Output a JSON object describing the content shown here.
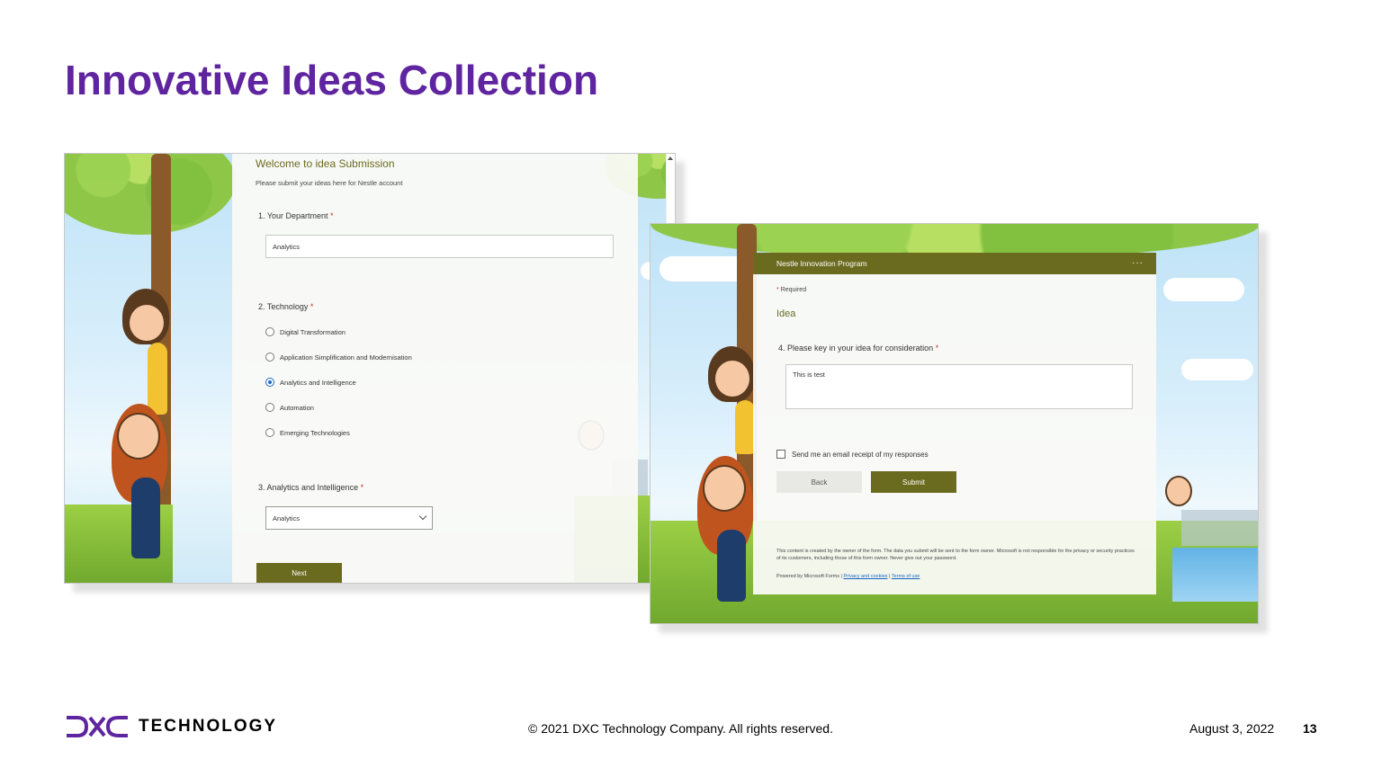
{
  "slide": {
    "title": "Innovative Ideas Collection"
  },
  "form1": {
    "title": "Welcome to idea Submission",
    "subtitle": "Please submit your ideas here for Nestle account",
    "q1": {
      "label": "1. Your Department",
      "required": "*",
      "value": "Analytics"
    },
    "q2": {
      "label": "2. Technology",
      "required": "*",
      "options": [
        {
          "label": "Digital Transformation",
          "checked": false
        },
        {
          "label": "Application Simplification and Modernisation",
          "checked": false
        },
        {
          "label": "Analytics and Intelligence",
          "checked": true
        },
        {
          "label": "Automation",
          "checked": false
        },
        {
          "label": "Emerging Technologies",
          "checked": false
        }
      ]
    },
    "q3": {
      "label": "3. Analytics and Intelligence",
      "required": "*",
      "selected": "Analytics"
    },
    "next_label": "Next"
  },
  "form2": {
    "header": "Nestle Innovation Program",
    "more": "···",
    "required_note": "Required",
    "required_star": "*",
    "section": "Idea",
    "q4": {
      "label": "4. Please key in your idea for consideration",
      "required": "*",
      "value": "This is test"
    },
    "receipt_label": "Send me an email receipt of my responses",
    "back_label": "Back",
    "submit_label": "Submit",
    "disclaimer": "This content is created by the owner of the form. The data you submit will be sent to the form owner. Microsoft is not responsible for the privacy or security practices of its customers, including those of this form owner. Never give out your password.",
    "powered_by": "Powered by Microsoft Forms |",
    "privacy_link": "Privacy and cookies",
    "separator": "|",
    "terms_link": "Terms of use"
  },
  "footer": {
    "logo_text": "TECHNOLOGY",
    "copyright": "© 2021 DXC Technology Company. All rights reserved.",
    "date": "August 3, 2022",
    "page": "13"
  },
  "colors": {
    "title_purple": "#5f249f",
    "olive": "#6b6b20",
    "required_red": "#c0392b",
    "radio_blue": "#1a66c8"
  }
}
